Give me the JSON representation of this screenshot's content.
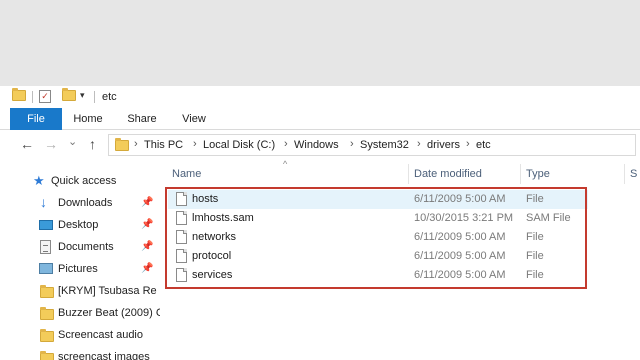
{
  "window": {
    "title": "etc"
  },
  "quick_access_toolbar": {
    "customize_glyph": "▾"
  },
  "ribbon": {
    "tabs": [
      {
        "label": "File",
        "active": true
      },
      {
        "label": "Home"
      },
      {
        "label": "Share"
      },
      {
        "label": "View"
      }
    ]
  },
  "navigation": {
    "back_glyph": "←",
    "forward_glyph": "→",
    "recent_glyph": "⌄",
    "up_glyph": "↑"
  },
  "address_bar": {
    "separator": "›",
    "breadcrumbs": [
      "This PC",
      "Local Disk (C:)",
      "Windows",
      "System32",
      "drivers",
      "etc"
    ]
  },
  "nav_pane": {
    "pin_glyph": "📌",
    "items": [
      {
        "label": "Quick access",
        "icon": "star-icon"
      },
      {
        "label": "Downloads",
        "icon": "download-icon",
        "pinned": true
      },
      {
        "label": "Desktop",
        "icon": "desktop-icon",
        "pinned": true
      },
      {
        "label": "Documents",
        "icon": "documents-icon",
        "pinned": true
      },
      {
        "label": "Pictures",
        "icon": "pictures-icon",
        "pinned": true
      },
      {
        "label": "[KRYM] Tsubasa Re",
        "icon": "folder-icon"
      },
      {
        "label": "Buzzer Beat (2009) C",
        "icon": "folder-icon"
      },
      {
        "label": "Screencast audio",
        "icon": "folder-icon"
      },
      {
        "label": "screencast images",
        "icon": "folder-icon"
      }
    ]
  },
  "file_list": {
    "sort_glyph": "^",
    "columns": [
      "Name",
      "Date modified",
      "Type",
      "S"
    ],
    "rows": [
      {
        "name": "hosts",
        "date": "6/11/2009 5:00 AM",
        "type": "File",
        "selected": true
      },
      {
        "name": "lmhosts.sam",
        "date": "10/30/2015 3:21 PM",
        "type": "SAM File"
      },
      {
        "name": "networks",
        "date": "6/11/2009 5:00 AM",
        "type": "File"
      },
      {
        "name": "protocol",
        "date": "6/11/2009 5:00 AM",
        "type": "File"
      },
      {
        "name": "services",
        "date": "6/11/2009 5:00 AM",
        "type": "File"
      }
    ]
  },
  "colors": {
    "file_tab": "#1979ca",
    "highlight": "#c43a2e",
    "selection": "#e5f3fb"
  }
}
